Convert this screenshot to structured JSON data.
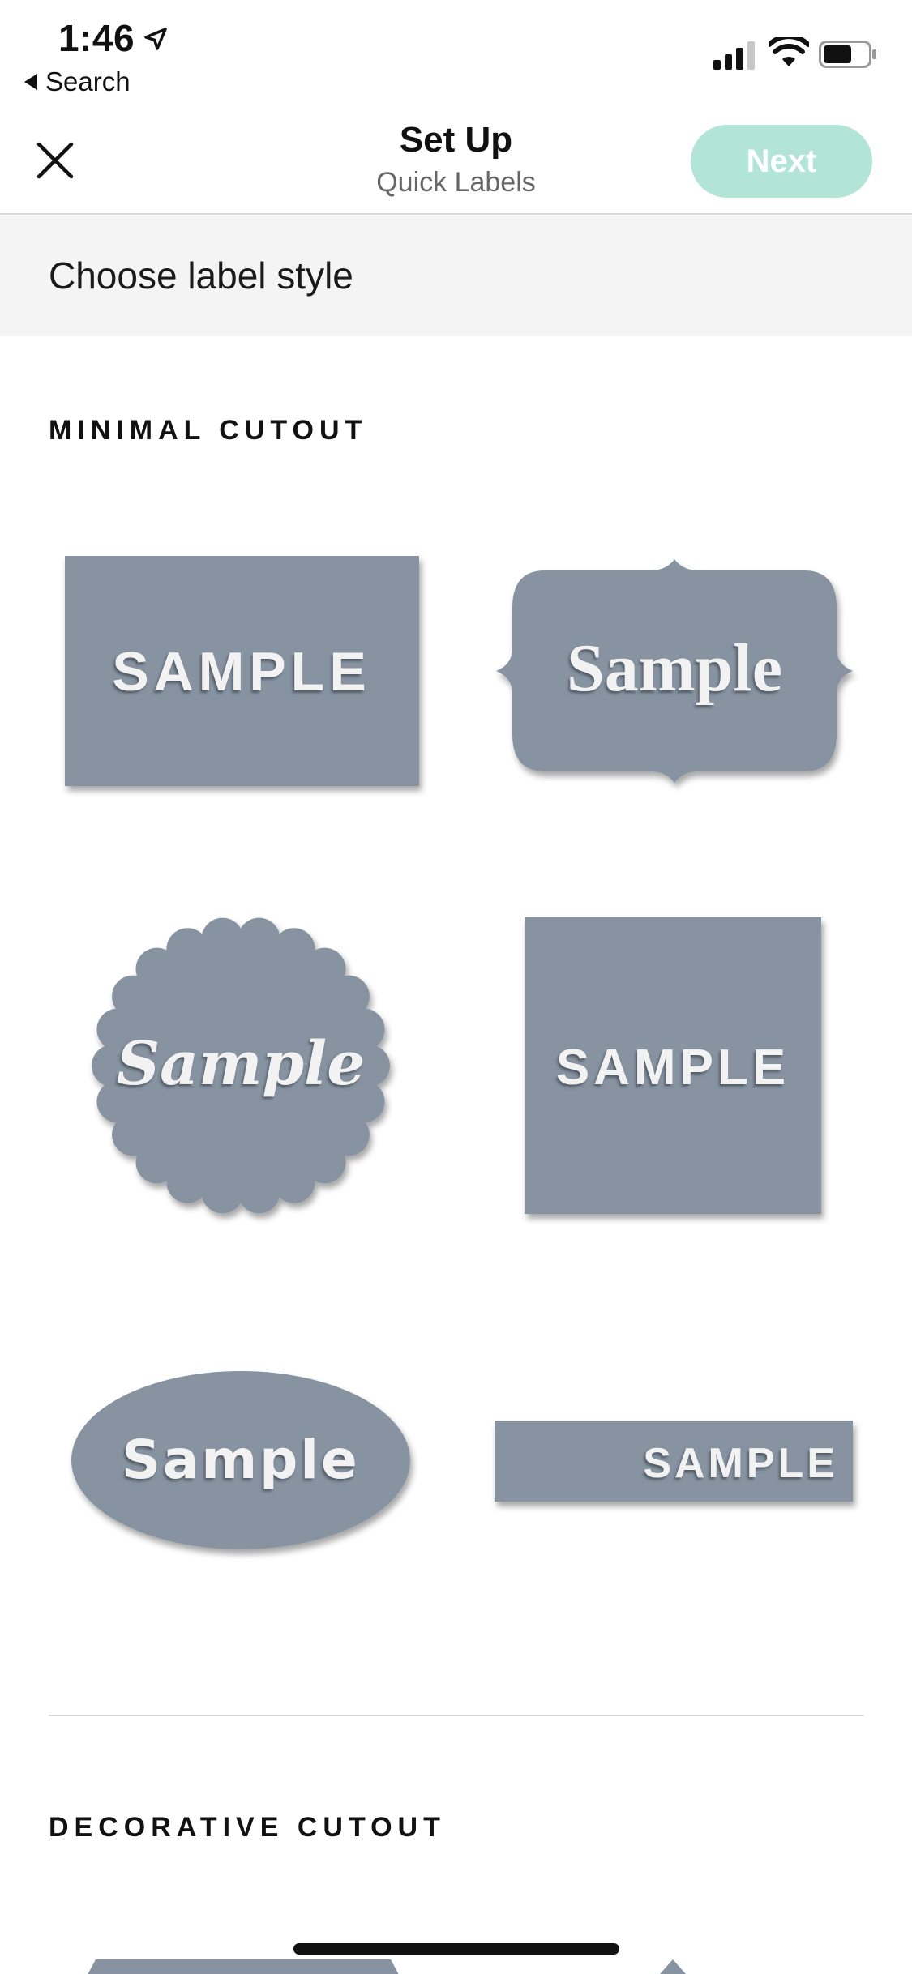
{
  "status_bar": {
    "time": "1:46",
    "back_label": "Search"
  },
  "nav": {
    "title": "Set Up",
    "subtitle": "Quick Labels",
    "next_label": "Next"
  },
  "section_band": {
    "text": "Choose label style"
  },
  "sections": [
    {
      "heading": "MINIMAL CUTOUT",
      "labels": [
        {
          "shape": "rectangle",
          "text": "SAMPLE"
        },
        {
          "shape": "bracket",
          "text": "Sample"
        },
        {
          "shape": "scalloped-circle",
          "text": "Sample"
        },
        {
          "shape": "square",
          "text": "SAMPLE"
        },
        {
          "shape": "oval",
          "text": "Sample"
        },
        {
          "shape": "strip",
          "text": "SAMPLE"
        }
      ]
    },
    {
      "heading": "DECORATIVE CUTOUT"
    }
  ],
  "colors": {
    "label_fill": "#8793a1",
    "next_button": "#b2e5d6",
    "band_bg": "#f4f4f4"
  }
}
